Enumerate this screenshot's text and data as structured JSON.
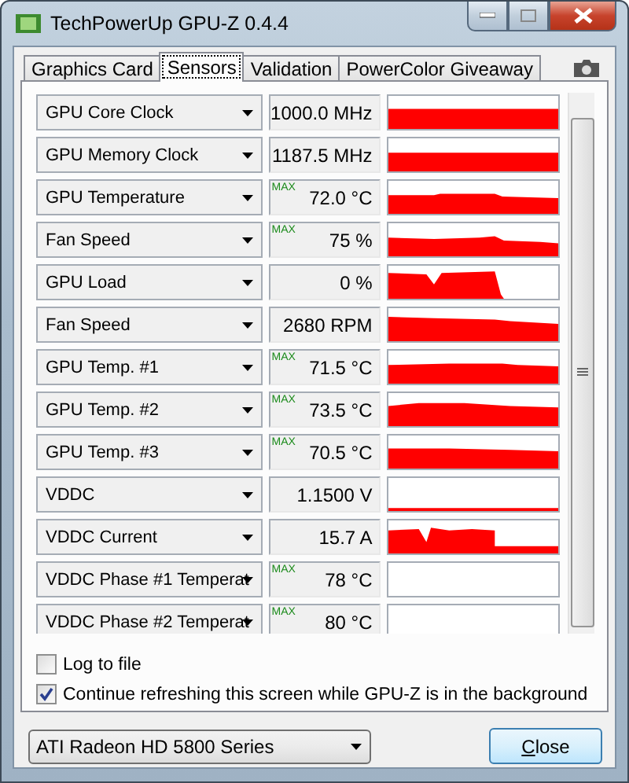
{
  "window": {
    "title": "TechPowerUp GPU-Z 0.4.4"
  },
  "tabs": [
    {
      "label": "Graphics Card",
      "selected": false
    },
    {
      "label": "Sensors",
      "selected": true
    },
    {
      "label": "Validation",
      "selected": false
    },
    {
      "label": "PowerColor Giveaway",
      "selected": false
    }
  ],
  "sensors": [
    {
      "name": "GPU Core Clock",
      "value": "1000.0 MHz"
    },
    {
      "name": "GPU Memory Clock",
      "value": "1187.5 MHz"
    },
    {
      "name": "GPU Temperature",
      "badge": "MAX",
      "value": "72.0 °C"
    },
    {
      "name": "Fan Speed",
      "badge": "MAX",
      "value": "75 %"
    },
    {
      "name": "GPU Load",
      "value": "0 %"
    },
    {
      "name": "Fan Speed",
      "value": "2680 RPM"
    },
    {
      "name": "GPU Temp. #1",
      "badge": "MAX",
      "value": "71.5 °C"
    },
    {
      "name": "GPU Temp. #2",
      "badge": "MAX",
      "value": "73.5 °C"
    },
    {
      "name": "GPU Temp. #3",
      "badge": "MAX",
      "value": "70.5 °C"
    },
    {
      "name": "VDDC",
      "value": "1.1500 V"
    },
    {
      "name": "VDDC Current",
      "value": "15.7 A"
    },
    {
      "name": "VDDC Phase #1 Temperat",
      "badge": "MAX",
      "value": "78 °C"
    },
    {
      "name": "VDDC Phase #2 Temperat",
      "badge": "MAX",
      "value": "80 °C"
    }
  ],
  "options": [
    {
      "label": "Log to file",
      "checked": false
    },
    {
      "label": "Continue refreshing this screen while GPU-Z is in the background",
      "checked": true
    }
  ],
  "card_select": {
    "value": "ATI Radeon HD 5800 Series"
  },
  "close_button": {
    "label": "Close"
  }
}
